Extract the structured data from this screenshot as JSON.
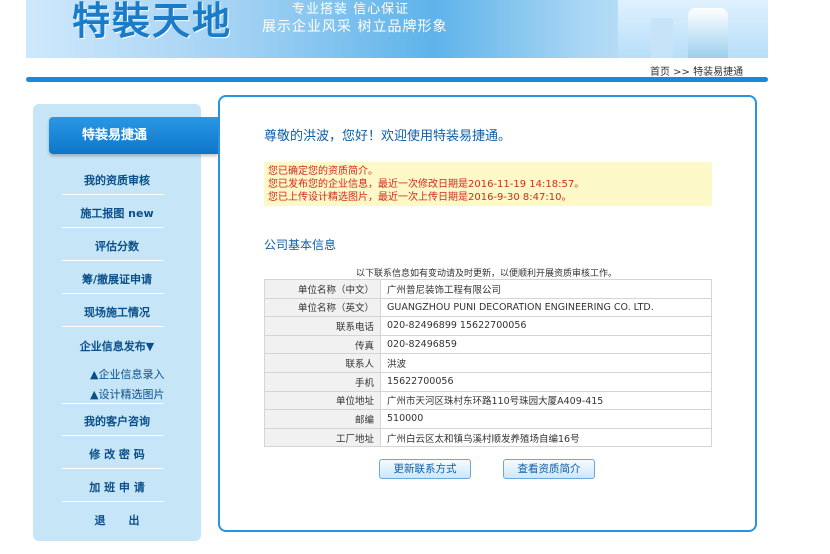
{
  "banner": {
    "logo_text": "特裝天地",
    "slogan_1": "专业搭装  信心保证",
    "slogan_2": "展示企业风采  树立品牌形象"
  },
  "breadcrumb": "首页 >> 特装易捷通",
  "sidebar": {
    "active": "特装易捷通",
    "items": [
      {
        "label": "我的资质审核"
      },
      {
        "label": "施工报图 new"
      },
      {
        "label": "评估分数"
      },
      {
        "label": "筹/撤展证申请"
      },
      {
        "label": "现场施工情况"
      },
      {
        "label": "企业信息发布▼"
      },
      {
        "label": "▲企业信息录入"
      },
      {
        "label": "▲设计精选图片"
      },
      {
        "label": "我的客户咨询"
      },
      {
        "label": "修 改 密 码"
      },
      {
        "label": "加 班 申 请"
      },
      {
        "label": "退      出"
      }
    ]
  },
  "main": {
    "welcome": "尊敬的洪波，您好！欢迎使用特装易捷通。",
    "notices": [
      "您已确定您的资质简介。",
      "您已发布您的企业信息，最近一次修改日期是2016-11-19 14:18:57。",
      "您已上传设计精选图片，最近一次上传日期是2016-9-30 8:47:10。"
    ],
    "section_title": "公司基本信息",
    "update_note": "以下联系信息如有变动请及时更新，以便顺利开展资质审核工作。",
    "rows": [
      {
        "label": "单位名称（中文）",
        "value": "广州普尼装饰工程有限公司"
      },
      {
        "label": "单位名称（英文）",
        "value": "GUANGZHOU PUNI DECORATION ENGINEERING CO. LTD."
      },
      {
        "label": "联系电话",
        "value": "020-82496899 15622700056"
      },
      {
        "label": "传真",
        "value": "020-82496859"
      },
      {
        "label": "联系人",
        "value": "洪波"
      },
      {
        "label": "手机",
        "value": "15622700056"
      },
      {
        "label": "单位地址",
        "value": "广州市天河区珠村东环路110号珠园大厦A409-415"
      },
      {
        "label": "邮编",
        "value": "510000"
      },
      {
        "label": "工厂地址",
        "value": "广州白云区太和镇乌溪村顺发养殖场自编16号"
      }
    ],
    "buttons": {
      "update": "更新联系方式",
      "view": "查看资质简介"
    }
  }
}
